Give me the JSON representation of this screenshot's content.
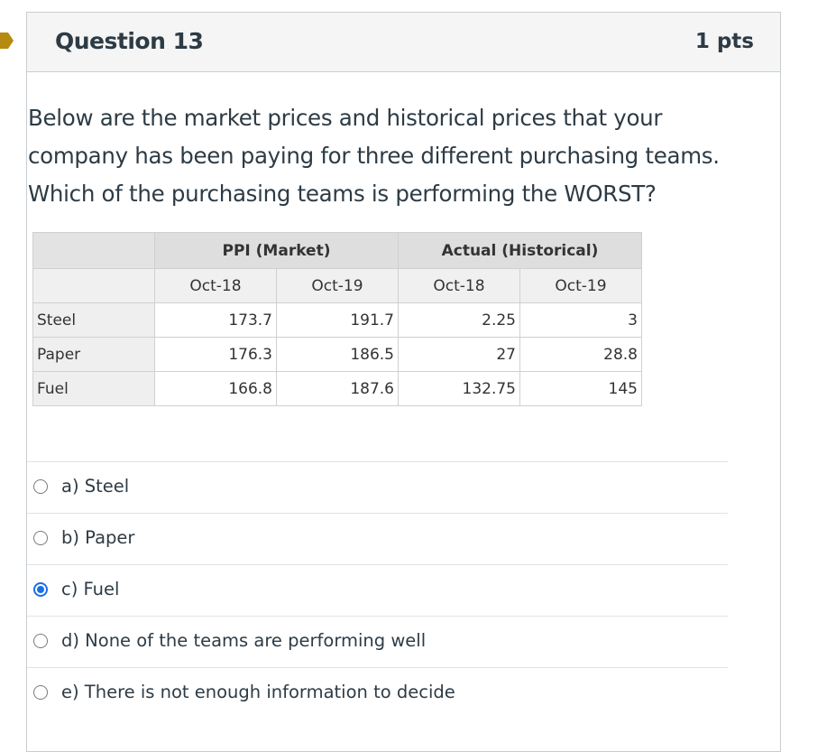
{
  "question": {
    "title": "Question 13",
    "points": "1 pts",
    "text": "Below are the market prices and historical prices that your company has been paying for three different purchasing teams. Which of the purchasing teams is performing the WORST?"
  },
  "table": {
    "group_headers": [
      "PPI (Market)",
      "Actual (Historical)"
    ],
    "sub_headers": [
      "Oct-18",
      "Oct-19",
      "Oct-18",
      "Oct-19"
    ],
    "rows": [
      {
        "label": "Steel",
        "values": [
          "173.7",
          "191.7",
          "2.25",
          "3"
        ]
      },
      {
        "label": "Paper",
        "values": [
          "176.3",
          "186.5",
          "27",
          "28.8"
        ]
      },
      {
        "label": "Fuel",
        "values": [
          "166.8",
          "187.6",
          "132.75",
          "145"
        ]
      }
    ]
  },
  "answers": [
    {
      "label": "a) Steel",
      "selected": false
    },
    {
      "label": "b) Paper",
      "selected": false
    },
    {
      "label": "c) Fuel",
      "selected": true
    },
    {
      "label": "d) None of the teams are performing well",
      "selected": false
    },
    {
      "label": "e) There is not enough information to decide",
      "selected": false
    }
  ],
  "colors": {
    "marker": "#b8860b",
    "radio_selected": "#1a6fe8"
  }
}
